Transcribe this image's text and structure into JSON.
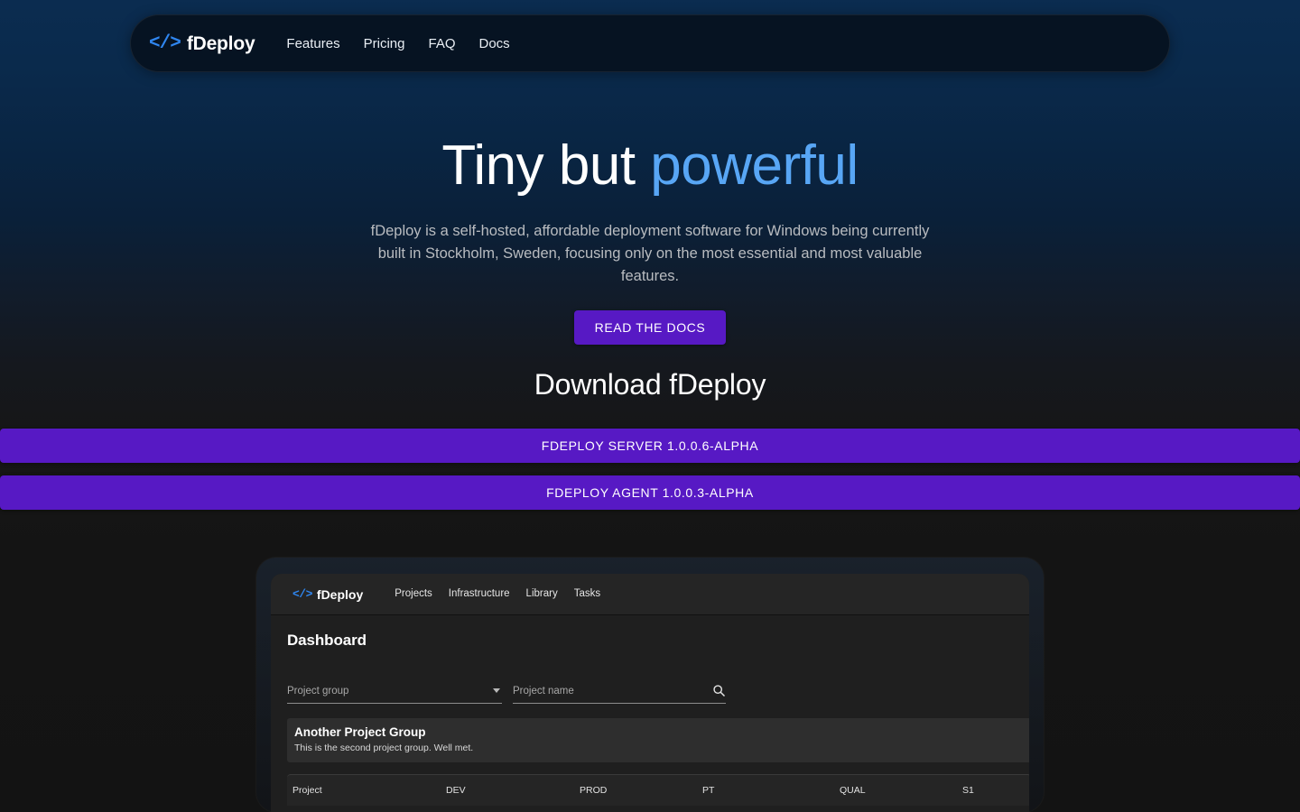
{
  "brand": {
    "mark": "</>",
    "name": "fDeploy",
    "mark_color": "#2f86f0"
  },
  "nav": {
    "links": [
      {
        "label": "Features"
      },
      {
        "label": "Pricing"
      },
      {
        "label": "FAQ"
      },
      {
        "label": "Docs"
      }
    ]
  },
  "hero": {
    "title_plain": "Tiny but ",
    "title_accent": "powerful",
    "accent_color": "#58a6f5",
    "subtitle": "fDeploy is a self-hosted, affordable deployment software for Windows being currently built in Stockholm, Sweden, focusing only on the most essential and most valuable features.",
    "cta_label": "READ THE DOCS",
    "cta_color": "#5719c4"
  },
  "download": {
    "title": "Download fDeploy",
    "buttons": [
      {
        "label": "FDEPLOY SERVER 1.0.0.6-ALPHA"
      },
      {
        "label": "FDEPLOY AGENT 1.0.0.3-ALPHA"
      }
    ]
  },
  "preview": {
    "app_brand": {
      "mark": "</>",
      "name": "fDeploy"
    },
    "app_nav_links": [
      {
        "label": "Projects"
      },
      {
        "label": "Infrastructure"
      },
      {
        "label": "Library"
      },
      {
        "label": "Tasks"
      }
    ],
    "page_title": "Dashboard",
    "filters": {
      "group_placeholder": "Project group",
      "group_value": "",
      "name_placeholder": "Project name",
      "name_value": "",
      "search_icon": "search-icon",
      "dropdown_icon": "chevron-down-icon"
    },
    "project_group": {
      "title": "Another Project Group",
      "description": "This is the second project group. Well met."
    },
    "table": {
      "columns": [
        "Project",
        "DEV",
        "PROD",
        "PT",
        "QUAL",
        "S1"
      ],
      "rows": []
    }
  }
}
